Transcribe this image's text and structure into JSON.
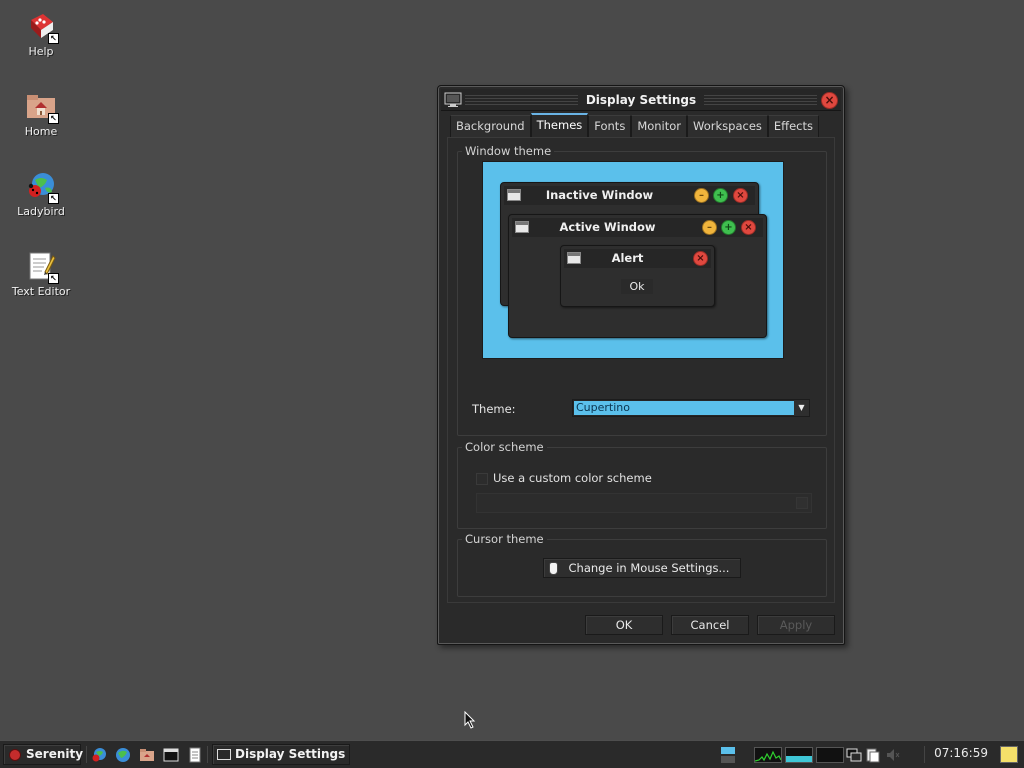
{
  "desktop": {
    "icons": [
      {
        "label": "Help",
        "icon": "help-book-icon"
      },
      {
        "label": "Home",
        "icon": "home-folder-icon"
      },
      {
        "label": "Ladybird",
        "icon": "ladybird-browser-icon"
      },
      {
        "label": "Text Editor",
        "icon": "text-editor-icon"
      }
    ]
  },
  "window": {
    "title": "Display Settings",
    "tabs": [
      "Background",
      "Themes",
      "Fonts",
      "Monitor",
      "Workspaces",
      "Effects"
    ],
    "active_tab": "Themes",
    "window_theme": {
      "legend": "Window theme",
      "preview": {
        "inactive_title": "Inactive Window",
        "active_title": "Active Window",
        "alert_title": "Alert",
        "alert_ok": "Ok",
        "background_color": "#5bc0eb"
      },
      "theme_label": "Theme:",
      "theme_value": "Cupertino"
    },
    "color_scheme": {
      "legend": "Color scheme",
      "checkbox_label": "Use a custom color scheme",
      "checked": false
    },
    "cursor_theme": {
      "legend": "Cursor theme",
      "button_label": "Change in Mouse Settings..."
    },
    "buttons": {
      "ok": "OK",
      "cancel": "Cancel",
      "apply": "Apply"
    }
  },
  "taskbar": {
    "start_label": "Serenity",
    "task_label": "Display Settings",
    "clock": "07:16:59"
  },
  "colors": {
    "accent": "#5bc0eb",
    "close": "#e0483f",
    "minimize": "#f0b43c",
    "maximize": "#3fbf4f"
  }
}
